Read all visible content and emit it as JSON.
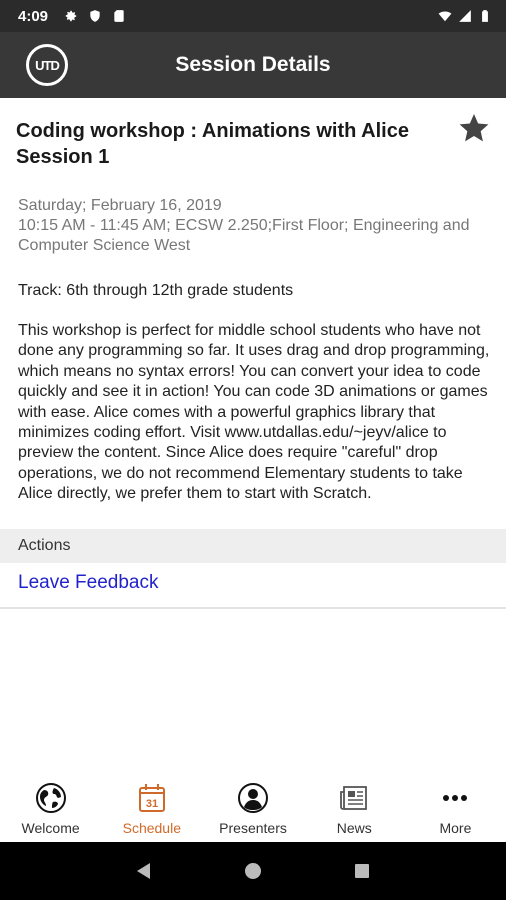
{
  "status_bar": {
    "time": "4:09",
    "left_icons": [
      "gear-icon",
      "shield-icon",
      "sd-card-icon"
    ],
    "right_icons": [
      "wifi-icon",
      "signal-icon",
      "battery-icon"
    ]
  },
  "app_bar": {
    "logo_text": "UTD",
    "title": "Session Details"
  },
  "session": {
    "title": "Coding workshop : Animations with Alice Session 1",
    "favorite_icon": "star-icon",
    "date": "Saturday; February 16, 2019",
    "time_location": "10:15 AM - 11:45 AM; ECSW 2.250;First Floor; Engineering and Computer Science West",
    "track": "Track: 6th through 12th grade students",
    "description": "This workshop is perfect for middle school students who have not done any programming so far. It uses drag and drop programming, which means no syntax errors! You can convert your idea to code quickly and see it in action! You can code 3D animations or games with ease. Alice comes with a powerful graphics library that minimizes coding effort. Visit www.utdallas.edu/~jeyv/alice to preview the content. Since Alice does require \"careful\" drop operations, we do not recommend Elementary students to take Alice directly, we prefer them to start with Scratch."
  },
  "actions": {
    "header": "Actions",
    "feedback_link": "Leave Feedback"
  },
  "bottom_nav": {
    "items": [
      {
        "label": "Welcome",
        "icon": "globe-icon"
      },
      {
        "label": "Schedule",
        "icon": "calendar-icon",
        "active": true,
        "calendar_day": "31"
      },
      {
        "label": "Presenters",
        "icon": "person-icon"
      },
      {
        "label": "News",
        "icon": "newspaper-icon"
      },
      {
        "label": "More",
        "icon": "more-dots-icon"
      }
    ]
  },
  "colors": {
    "status_bar": "#2b2b2b",
    "app_bar": "#383838",
    "active_nav": "#d06a2a",
    "link": "#2222cc",
    "section_header_bg": "#eeeeee"
  }
}
